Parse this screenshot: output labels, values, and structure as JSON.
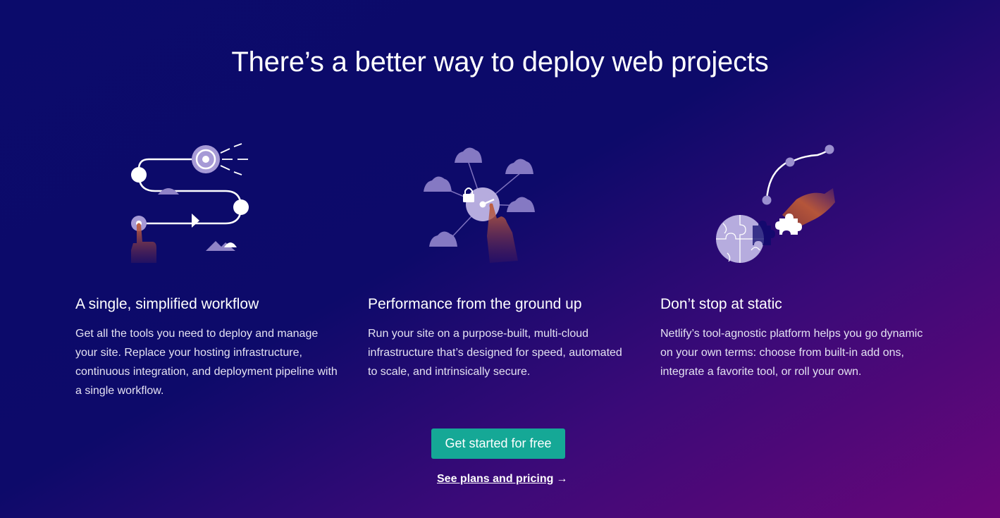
{
  "header": {
    "title": "There’s a better way to deploy web projects"
  },
  "features": [
    {
      "icon": "workflow-illustration",
      "title": "A single, simplified workflow",
      "description": "Get all the tools you need to deploy and manage your site. Replace your hosting infrastructure, continuous integration, and deployment pipeline with a single workflow."
    },
    {
      "icon": "multi-cloud-illustration",
      "title": "Performance from the ground up",
      "description": "Run your site on a purpose-built, multi-cloud infrastructure that’s designed for speed, automated to scale, and intrinsically secure."
    },
    {
      "icon": "puzzle-illustration",
      "title": "Don’t stop at static",
      "description": "Netlify’s tool-agnostic platform helps you go dynamic on your own terms: choose from built-in add ons, integrate a favorite tool, or roll your own."
    }
  ],
  "cta": {
    "primary_label": "Get started for free",
    "secondary_label": "See plans and pricing",
    "secondary_arrow": "→"
  },
  "colors": {
    "background_start": "#0b0b6b",
    "background_end": "#6a0679",
    "button": "#15a896",
    "accent_lavender": "#a69ad6",
    "hand": "#b5553a"
  }
}
